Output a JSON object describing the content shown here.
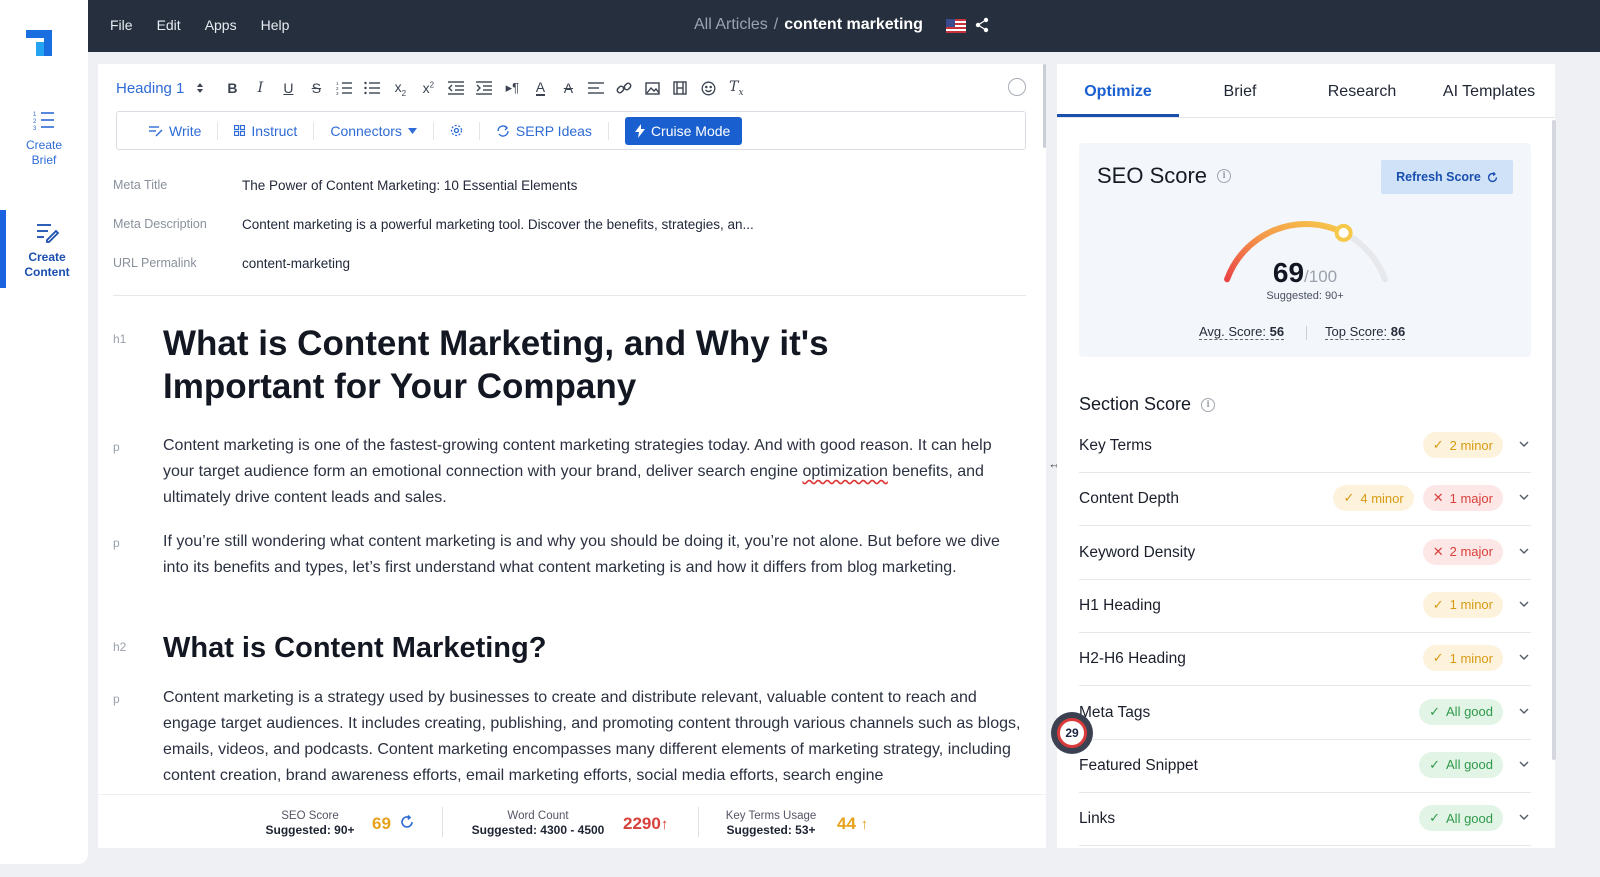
{
  "topbar": {
    "menu": [
      "File",
      "Edit",
      "Apps",
      "Help"
    ],
    "breadcrumb_parent": "All Articles",
    "breadcrumb_sep": "/",
    "breadcrumb_current": "content marketing"
  },
  "rail": {
    "create_brief": "Create Brief",
    "create_content": "Create Content"
  },
  "toolbar": {
    "heading_select": "Heading 1",
    "write": "Write",
    "instruct": "Instruct",
    "connectors": "Connectors",
    "serp_ideas": "SERP Ideas",
    "cruise_mode": "Cruise Mode"
  },
  "meta": {
    "title_label": "Meta Title",
    "title_value": "The Power of Content Marketing: 10 Essential Elements",
    "desc_label": "Meta Description",
    "desc_value": "Content marketing is a powerful marketing tool. Discover the benefits, strategies, an...",
    "url_label": "URL Permalink",
    "url_value": "content-marketing"
  },
  "content": {
    "tag_h1": "h1",
    "h1": "What is Content Marketing, and Why it's Important for Your Company",
    "tag_p": "p",
    "p1_a": "Content marketing is one of the fastest-growing content marketing strategies today. And with good reason. It can help your target audience form an emotional connection with your brand, deliver search engine ",
    "p1_spell": "optimization",
    "p1_b": " benefits, and ultimately drive content leads and sales.",
    "p2": "If you’re still wondering what content marketing is and why you should be doing it, you’re not alone. But before we dive into its benefits and types, let’s first understand what content marketing is and how it differs from blog marketing.",
    "tag_h2": "h2",
    "h2": "What is Content Marketing?",
    "p3": "Content marketing is a strategy used by businesses to create and distribute relevant, valuable content to reach and engage target audiences. It includes creating, publishing, and promoting content through various channels such as blogs, emails, videos, and podcasts. Content marketing encompasses many different elements of marketing strategy, including content creation, brand awareness efforts, email marketing efforts, social media efforts, search engine"
  },
  "footer": {
    "seo_label": "SEO Score",
    "seo_suggest": "Suggested: 90+",
    "seo_value": "69",
    "wc_label": "Word Count",
    "wc_suggest": "Suggested: 4300 - 4500",
    "wc_value": "2290",
    "kt_label": "Key Terms Usage",
    "kt_suggest": "Suggested: 53+",
    "kt_value": "44"
  },
  "panel": {
    "tabs": [
      "Optimize",
      "Brief",
      "Research",
      "AI Templates"
    ],
    "seo_title": "SEO Score",
    "refresh": "Refresh Score",
    "score": "69",
    "score_max": "/100",
    "score_fraction": 0.69,
    "suggested": "Suggested: 90+",
    "avg_label": "Avg. Score:",
    "avg_value": "56",
    "top_label": "Top Score:",
    "top_value": "86",
    "section_title": "Section Score",
    "sections": [
      {
        "label": "Key Terms",
        "pills": [
          {
            "kind": "minor",
            "text": "2 minor"
          }
        ]
      },
      {
        "label": "Content Depth",
        "pills": [
          {
            "kind": "minor",
            "text": "4 minor"
          },
          {
            "kind": "major",
            "text": "1 major"
          }
        ]
      },
      {
        "label": "Keyword Density",
        "pills": [
          {
            "kind": "major",
            "text": "2 major"
          }
        ]
      },
      {
        "label": "H1 Heading",
        "pills": [
          {
            "kind": "minor",
            "text": "1 minor"
          }
        ]
      },
      {
        "label": "H2-H6 Heading",
        "pills": [
          {
            "kind": "minor",
            "text": "1 minor"
          }
        ]
      },
      {
        "label": "Meta Tags",
        "pills": [
          {
            "kind": "good",
            "text": "All good"
          }
        ]
      },
      {
        "label": "Featured Snippet",
        "pills": [
          {
            "kind": "good",
            "text": "All good"
          }
        ]
      },
      {
        "label": "Links",
        "pills": [
          {
            "kind": "good",
            "text": "All good"
          }
        ]
      }
    ]
  },
  "floating_badge": "29",
  "colors": {
    "accent": "#1a5fd0",
    "topbar": "#262f3d",
    "minor": "#d79a12",
    "major": "#d8403a",
    "good": "#2f9a4a"
  }
}
